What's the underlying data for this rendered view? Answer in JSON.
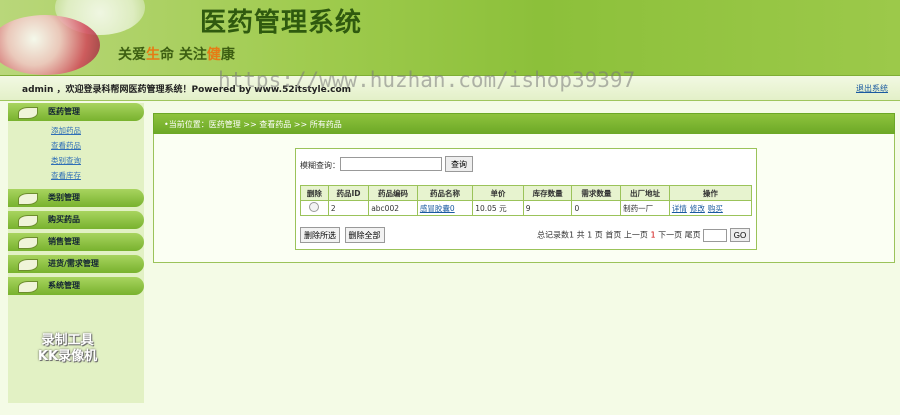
{
  "header": {
    "title": "医药管理系统",
    "slogan_a": "关爱",
    "slogan_b": "生",
    "slogan_c": "命   关注",
    "slogan_d": "健",
    "slogan_e": "康"
  },
  "status": {
    "welcome": "admin ，欢迎登录科帮网医药管理系统！Powered by www.52itstyle.com",
    "logout": "退出系统"
  },
  "watermark": "https://www.huzhan.com/ishop39397",
  "sidebar": {
    "groups": [
      {
        "label": "医药管理",
        "items": [
          "添加药品",
          "查看药品",
          "类别查询",
          "查看库存"
        ]
      },
      {
        "label": "类别管理"
      },
      {
        "label": "购买药品"
      },
      {
        "label": "销售管理"
      },
      {
        "label": "进货/需求管理"
      },
      {
        "label": "系统管理"
      }
    ],
    "recorder_logo_1": "录制工具",
    "recorder_logo_2": "KK录像机"
  },
  "breadcrumb": "•当前位置：医药管理 >> 查看药品 >> 所有药品",
  "search": {
    "label": "模糊查询：",
    "value": "",
    "button": "查询"
  },
  "table": {
    "headers": [
      "删除",
      "药品ID",
      "药品编码",
      "药品名称",
      "单价",
      "库存数量",
      "需求数量",
      "出厂地址",
      "操作"
    ],
    "rows": [
      {
        "id": "2",
        "code": "abc002",
        "name": "感冒胶囊0",
        "price": "10.05 元",
        "stock": "9",
        "demand": "0",
        "factory": "制药一厂",
        "ops": [
          "详情",
          "修改",
          "购买"
        ]
      }
    ]
  },
  "buttons": {
    "delete_selected": "删除所选",
    "delete_all": "删除全部"
  },
  "pager": {
    "pre": "总记录数1 共 1 页 首页 上一页",
    "current": "1",
    "post": "下一页 尾页",
    "go": "GO"
  }
}
